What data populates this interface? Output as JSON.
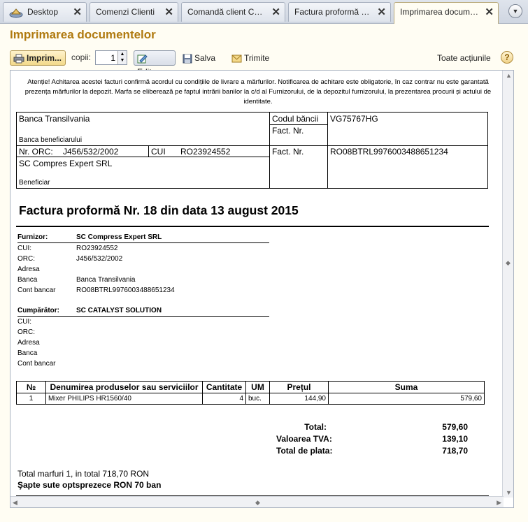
{
  "tabs": [
    {
      "label": "Desktop",
      "icon": "desktop-icon"
    },
    {
      "label": "Comenzi Clienti"
    },
    {
      "label": "Comandă client CMF..."
    },
    {
      "label": "Factura proformă emi..."
    },
    {
      "label": "Imprimarea document..."
    }
  ],
  "window": {
    "title": "Imprimarea documentelor"
  },
  "toolbar": {
    "print_label": "Imprim...",
    "copies_label": "copii:",
    "copies_value": "1",
    "edit_label": "Editare",
    "save_label": "Salva ...",
    "send_label": "Trimite ...",
    "actions_label": "Toate acțiunile",
    "help_label": "?"
  },
  "document": {
    "notice": "Atenție! Achitarea acestei facturi confirmă acordul cu condițiile de livrare a mărfurilor. Notificarea de achitare este obligatorie, în caz contrar nu este garantată prezența mărfurilor la depozit. Marfa se eliberează pe faptul intrării banilor la c/d al Furnizorului, de la depozitul furnizorului, la prezentarea procurii și actului de identitate.",
    "bank": {
      "bank_name": "Banca Transilvania",
      "bank_caption": "Banca beneficiarului",
      "bank_code_label": "Codul băncii",
      "bank_code_value": "VG75767HG",
      "fact_nr_label_1": "Fact. Nr.",
      "orc_label": "Nr. ORC:",
      "orc_value": "J456/532/2002",
      "cui_label": "CUI",
      "cui_value": "RO23924552",
      "fact_nr_label_2": "Fact. Nr.",
      "account_value": "RO08BTRL9976003488651234",
      "beneficiary_name": "SC Compres Expert SRL",
      "beneficiary_caption": "Beneficiar"
    },
    "heading": "Factura proformă Nr. 18 din data 13 august 2015",
    "supplier": {
      "title": "Furnizor:",
      "name": "SC Compress Expert SRL",
      "rows": [
        {
          "label": "CUI:",
          "value": "RO23924552"
        },
        {
          "label": "ORC:",
          "value": "J456/532/2002"
        },
        {
          "label": "Adresa",
          "value": ""
        },
        {
          "label": "Banca",
          "value": "Banca Transilvania"
        },
        {
          "label": "Cont bancar",
          "value": "RO08BTRL9976003488651234"
        }
      ]
    },
    "buyer": {
      "title": "Cumpărător:",
      "name": "SC CATALYST SOLUTION",
      "rows": [
        {
          "label": "CUI:",
          "value": ""
        },
        {
          "label": "ORC:",
          "value": ""
        },
        {
          "label": "Adresa",
          "value": ""
        },
        {
          "label": "Banca",
          "value": ""
        },
        {
          "label": "Cont bancar",
          "value": ""
        }
      ]
    },
    "table": {
      "headers": [
        "№",
        "Denumirea produselor sau serviciilor",
        "Cantitate",
        "UM",
        "Prețul",
        "Suma"
      ],
      "rows": [
        [
          "1",
          "Mixer PHILIPS HR1560/40",
          "4",
          "buc.",
          "144,90",
          "579,60"
        ]
      ]
    },
    "totals": [
      {
        "label": "Total:",
        "value": "579,60"
      },
      {
        "label": "Valoarea TVA:",
        "value": "139,10"
      },
      {
        "label": "Total de plata:",
        "value": "718,70"
      }
    ],
    "summary_line": "Total marfuri 1, in total 718,70 RON",
    "amount_words": "Şapte sute optsprezece RON 70 ban"
  }
}
